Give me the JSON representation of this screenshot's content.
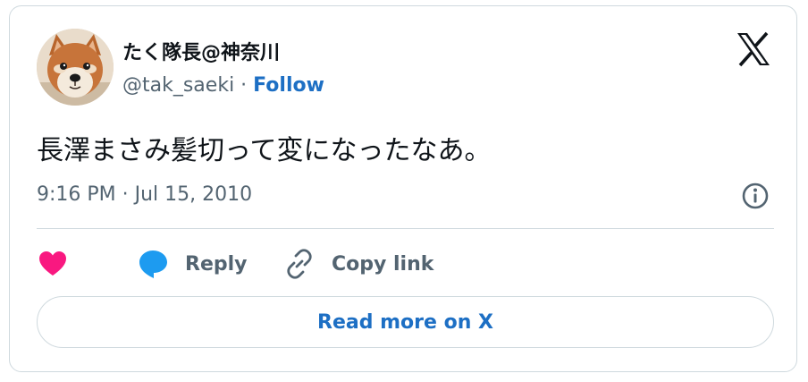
{
  "author": {
    "display_name": "たく隊長@神奈川",
    "handle": "@tak_saeki",
    "separator": " · ",
    "follow_label": "Follow",
    "avatar_icon": "shiba-dog-avatar"
  },
  "brand": {
    "logo_icon": "x-logo-icon"
  },
  "tweet": {
    "text": "長澤まさみ髪切って変になったなあ。",
    "timestamp": "9:16 PM · Jul 15, 2010"
  },
  "actions": {
    "like_icon": "heart-icon",
    "reply_label": "Reply",
    "reply_icon": "speech-bubble-icon",
    "copy_label": "Copy link",
    "copy_icon": "link-icon",
    "info_icon": "info-icon"
  },
  "footer": {
    "read_more_label": "Read more on X"
  },
  "colors": {
    "like": "#f91880",
    "reply": "#1d9bf0",
    "link_blue": "#1d6fc4",
    "text": "#0f1419",
    "muted": "#536471",
    "border": "#cfd9de"
  }
}
